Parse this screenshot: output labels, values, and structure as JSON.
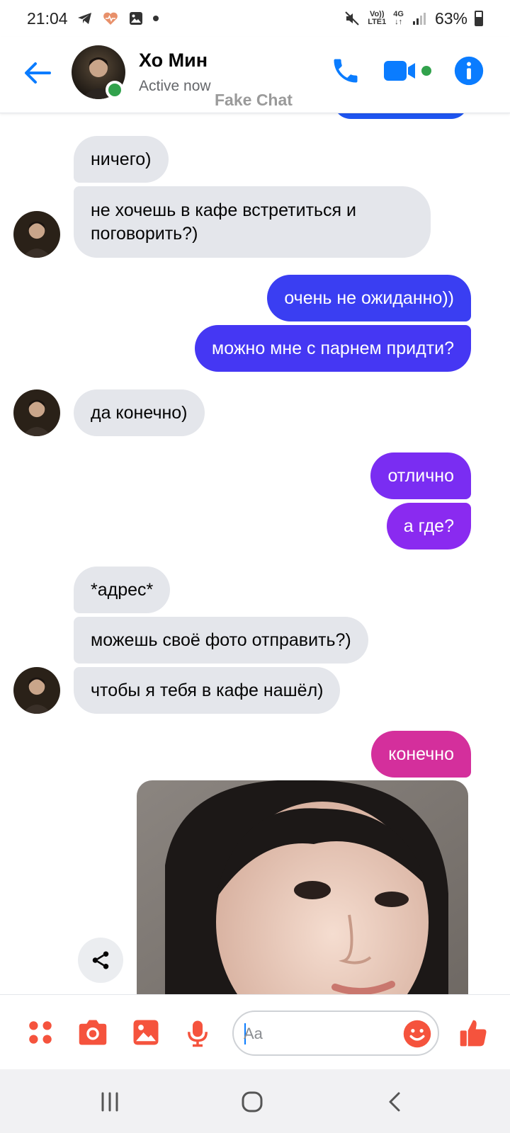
{
  "status_bar": {
    "time": "21:04",
    "net_top": "Vo))",
    "net_bottom": "LTE1",
    "gen": "4G",
    "battery": "63%"
  },
  "header": {
    "contact_name": "Хо Мин",
    "contact_status": "Active now",
    "watermark": "Fake Chat"
  },
  "messages": [
    {
      "from": "them",
      "text": "ничего)"
    },
    {
      "from": "them",
      "text": "не хочешь в кафе встретиться и поговорить?)"
    },
    {
      "from": "me",
      "text": "очень не ожиданно))"
    },
    {
      "from": "me",
      "text": "можно мне с парнем придти?"
    },
    {
      "from": "them",
      "text": "да конечно)"
    },
    {
      "from": "me",
      "text": "отлично"
    },
    {
      "from": "me",
      "text": "а где?"
    },
    {
      "from": "them",
      "text": "*адрес*"
    },
    {
      "from": "them",
      "text": "можешь своё фото отправить?)"
    },
    {
      "from": "them",
      "text": "чтобы я тебя в кафе нашёл)"
    },
    {
      "from": "me",
      "text": "конечно"
    },
    {
      "from": "me",
      "type": "photo"
    }
  ],
  "composer": {
    "placeholder": "Aa"
  },
  "colors": {
    "accent": "#0a7cff",
    "incoming_bubble": "#e4e6eb",
    "composer_icons": "#f5533d",
    "online": "#31a24c"
  },
  "icons": {
    "header": [
      "back-arrow-icon",
      "phone-icon",
      "video-camera-icon",
      "info-icon"
    ],
    "composer": [
      "apps-grid-icon",
      "camera-icon",
      "gallery-icon",
      "microphone-icon",
      "emoji-icon",
      "thumbs-up-icon"
    ],
    "navbar": [
      "recent-apps-icon",
      "home-icon",
      "back-nav-icon"
    ]
  }
}
